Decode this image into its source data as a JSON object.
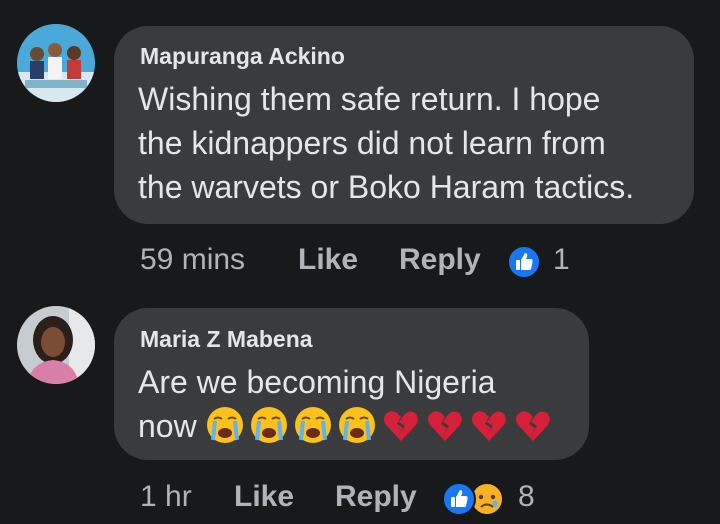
{
  "comments": [
    {
      "author": "Mapuranga Ackino",
      "text_lines": [
        "Wishing them safe return. I hope",
        "the kidnappers did not learn from",
        "the warvets or Boko Haram tactics."
      ],
      "time": "59 mins",
      "like_label": "Like",
      "reply_label": "Reply",
      "reaction_icons": [
        "like-icon"
      ],
      "reaction_count": "1"
    },
    {
      "author": "Maria Z Mabena",
      "text_lines": [
        "Are we becoming Nigeria",
        "now"
      ],
      "emojis": [
        "crying-face",
        "crying-face",
        "crying-face",
        "crying-face",
        "broken-heart",
        "broken-heart",
        "broken-heart",
        "broken-heart"
      ],
      "time": "1 hr",
      "like_label": "Like",
      "reply_label": "Reply",
      "reaction_icons": [
        "like-icon",
        "sad-icon"
      ],
      "reaction_count": "8"
    }
  ],
  "colors": {
    "background": "#18191a",
    "bubble": "#3a3b3c",
    "text": "#e4e6eb",
    "meta": "#b0b3b8",
    "like_blue": "#1877f2",
    "sad_yellow": "#f7b125",
    "broken_heart_red": "#d6203a"
  }
}
